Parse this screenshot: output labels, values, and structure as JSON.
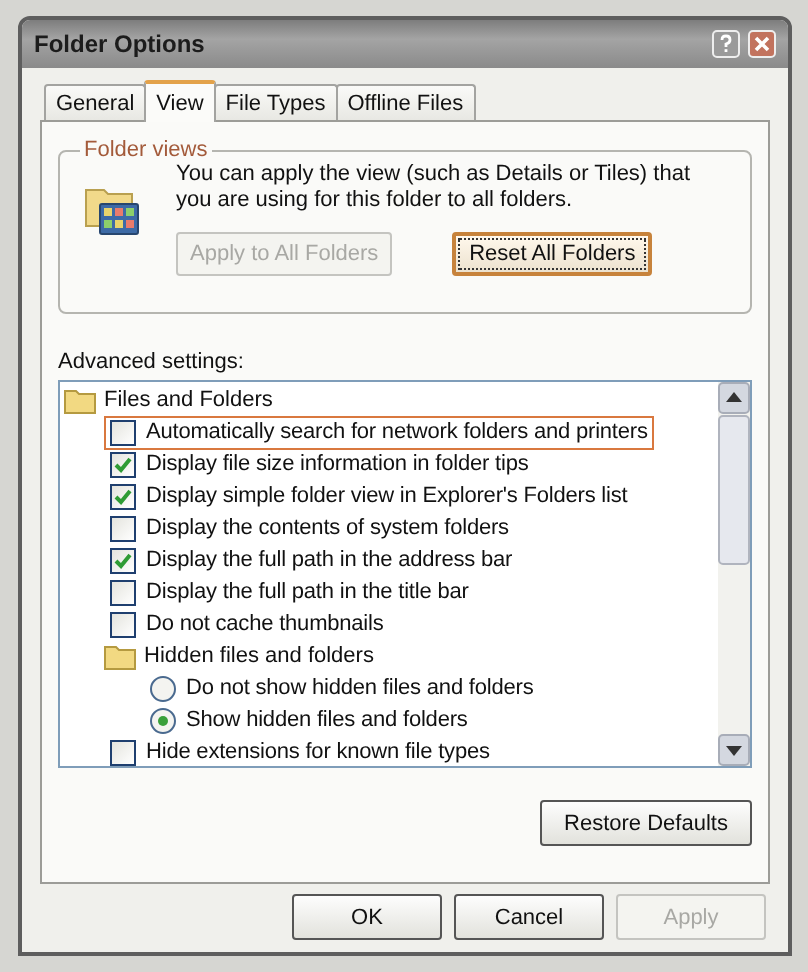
{
  "window": {
    "title": "Folder Options"
  },
  "tabs": [
    {
      "label": "General",
      "selected": false
    },
    {
      "label": "View",
      "selected": true
    },
    {
      "label": "File Types",
      "selected": false
    },
    {
      "label": "Offline Files",
      "selected": false
    }
  ],
  "folder_views": {
    "title": "Folder views",
    "description": "You can apply the view (such as Details or Tiles) that you are using for this folder to all folders.",
    "buttons": [
      {
        "label": "Apply to All Folders",
        "disabled": true,
        "focused": false
      },
      {
        "label": "Reset All Folders",
        "disabled": false,
        "focused": true
      }
    ]
  },
  "advanced": {
    "label": "Advanced settings:",
    "items": [
      {
        "kind": "folder",
        "label": "Files and Folders",
        "children": [
          {
            "kind": "checkbox",
            "label": "Automatically search for network folders and printers",
            "checked": false,
            "highlighted": true
          },
          {
            "kind": "checkbox",
            "label": "Display file size information in folder tips",
            "checked": true,
            "highlighted": false
          },
          {
            "kind": "checkbox",
            "label": "Display simple folder view in Explorer's Folders list",
            "checked": true,
            "highlighted": false
          },
          {
            "kind": "checkbox",
            "label": "Display the contents of system folders",
            "checked": false,
            "highlighted": false
          },
          {
            "kind": "checkbox",
            "label": "Display the full path in the address bar",
            "checked": true,
            "highlighted": false
          },
          {
            "kind": "checkbox",
            "label": "Display the full path in the title bar",
            "checked": false,
            "highlighted": false
          },
          {
            "kind": "checkbox",
            "label": "Do not cache thumbnails",
            "checked": false,
            "highlighted": false
          },
          {
            "kind": "folder",
            "label": "Hidden files and folders",
            "children": [
              {
                "kind": "radio",
                "label": "Do not show hidden files and folders",
                "selected": false,
                "highlighted": false
              },
              {
                "kind": "radio",
                "label": "Show hidden files and folders",
                "selected": true,
                "highlighted": false
              }
            ]
          },
          {
            "kind": "checkbox",
            "label": "Hide extensions for known file types",
            "checked": false,
            "highlighted": false
          }
        ]
      }
    ]
  },
  "restore_button": {
    "label": "Restore Defaults",
    "disabled": false
  },
  "buttons": [
    {
      "label": "OK",
      "disabled": false
    },
    {
      "label": "Cancel",
      "disabled": false
    },
    {
      "label": "Apply",
      "disabled": true
    }
  ]
}
